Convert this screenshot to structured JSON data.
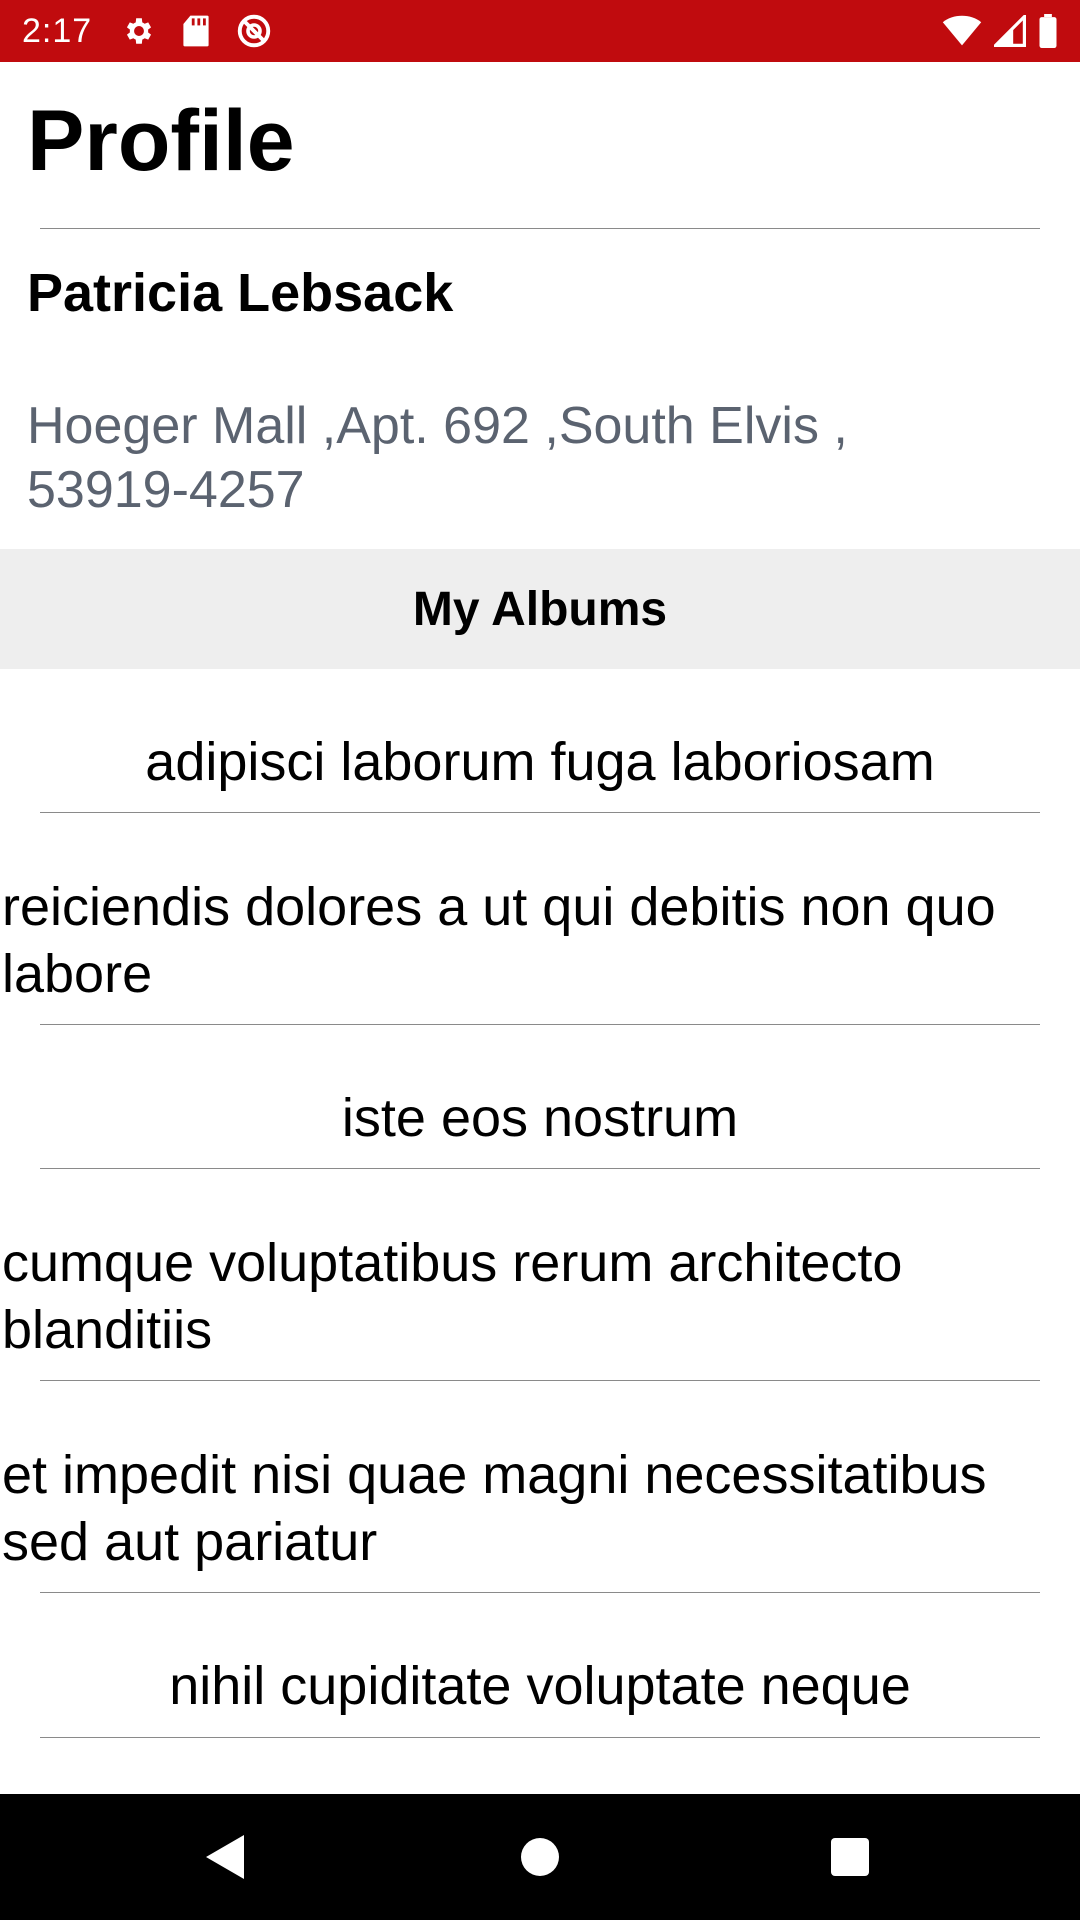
{
  "status_bar": {
    "time": "2:17",
    "left_icons": [
      "gear-icon",
      "sd-card-icon",
      "no-sync-icon"
    ],
    "right_icons": [
      "wifi-icon",
      "signal-icon",
      "battery-icon"
    ],
    "background_color": "#c00b0e"
  },
  "page": {
    "title": "Profile"
  },
  "user": {
    "name": "Patricia Lebsack",
    "address_line1": "Hoeger Mall ,Apt. 692 ,South Elvis ,",
    "address_line2": "53919-4257"
  },
  "albums": {
    "header": "My Albums",
    "items": [
      "adipisci laborum fuga laboriosam",
      "reiciendis dolores a ut qui debitis non quo labore",
      "iste eos nostrum",
      "cumque voluptatibus rerum architecto blanditiis",
      "et impedit nisi quae magni necessitatibus sed aut pariatur",
      "nihil cupiditate voluptate neque"
    ]
  },
  "nav_bar": {
    "buttons": [
      "back-icon",
      "home-icon",
      "recents-icon"
    ]
  }
}
